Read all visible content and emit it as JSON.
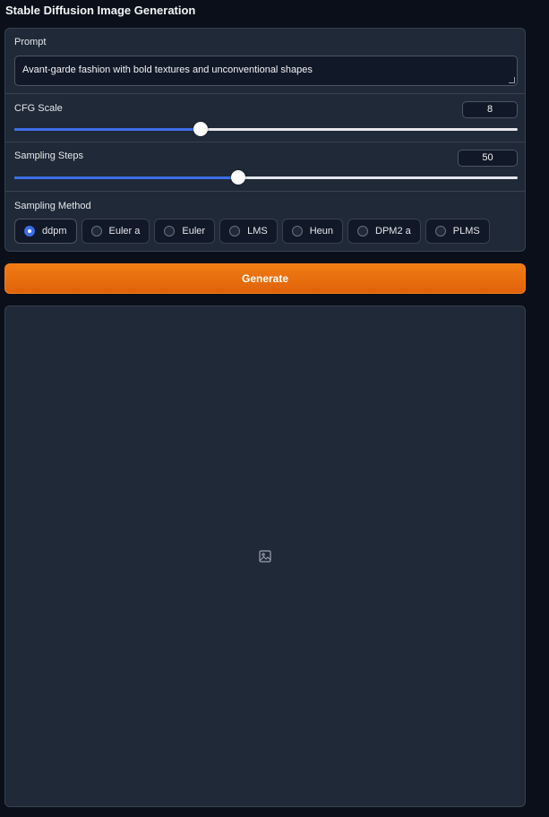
{
  "app": {
    "title": "Stable Diffusion Image Generation"
  },
  "prompt": {
    "label": "Prompt",
    "value": "Avant-garde fashion with bold textures and unconventional shapes"
  },
  "cfg_scale": {
    "label": "CFG Scale",
    "value": "8",
    "fraction": 0.37
  },
  "sampling_steps": {
    "label": "Sampling Steps",
    "value": "50",
    "fraction": 0.445
  },
  "sampling_method": {
    "label": "Sampling Method",
    "selected": "ddpm",
    "options": [
      "ddpm",
      "Euler a",
      "Euler",
      "LMS",
      "Heun",
      "DPM2 a",
      "PLMS"
    ]
  },
  "generate": {
    "label": "Generate"
  },
  "output": {
    "icon": "image-icon"
  },
  "colors": {
    "background": "#0b0f19",
    "panel": "#1f2937",
    "accent": "#3b6ee8",
    "button": "#ea6a0d"
  }
}
